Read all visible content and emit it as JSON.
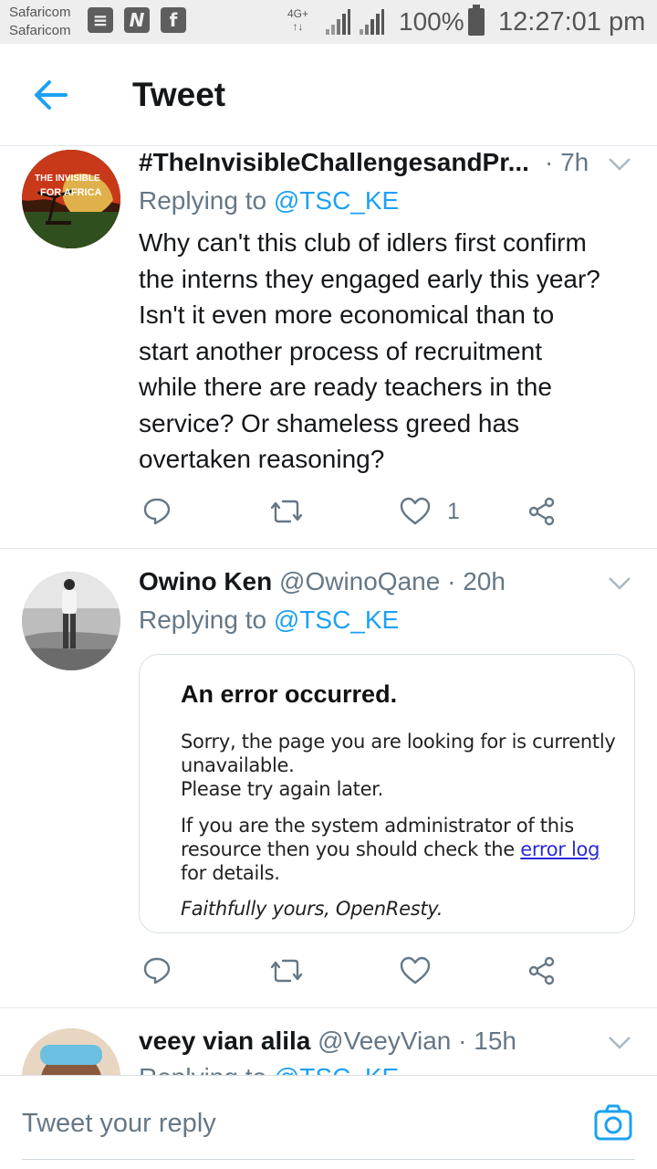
{
  "status_bar": {
    "carrier_1": "Safaricom",
    "carrier_2": "Safaricom",
    "network": "4G+",
    "battery": "100%",
    "time": "12:27:01 pm",
    "notification_icons": [
      "document-icon",
      "n-icon",
      "facebook-icon"
    ]
  },
  "header": {
    "title": "Tweet",
    "back_icon": "arrow-left-icon"
  },
  "tweets": [
    {
      "name": "#TheInvisibleChallengesandPr...",
      "handle": "",
      "time": "· 7h",
      "replying_prefix": "Replying to",
      "replying_to": "@TSC_KE",
      "avatar_text_1": "THE INVISIBLE",
      "avatar_text_2": "FOR AFRICA",
      "text_lines": [
        "Why can't this club of idlers first confirm",
        "the interns they engaged early this year?",
        "Isn't it even more economical than to",
        "start another process of recruitment",
        "while there are ready teachers in the",
        "service? Or shameless greed has",
        "overtaken reasoning?"
      ],
      "likes": "1"
    },
    {
      "name": "Owino Ken",
      "handle": "@OwinoQane",
      "time": "· 20h",
      "replying_prefix": "Replying to",
      "replying_to": "@TSC_KE",
      "card": {
        "heading": "An error occurred.",
        "line_1": "Sorry, the page you are looking for is currently",
        "line_2": "unavailable.",
        "line_3": "Please try again later.",
        "line_4": "If you are the system administrator of this",
        "line_5_prefix": "resource then you should check the ",
        "line_5_link": "error log",
        "line_6": "for details.",
        "signature": "Faithfully yours, OpenResty."
      },
      "likes": ""
    },
    {
      "name": "veey vian alila",
      "handle": "@VeeyVian",
      "time": "· 15h",
      "replying_prefix": "Replying to",
      "replying_to": "@TSC_KE"
    }
  ],
  "composer": {
    "placeholder": "Tweet your reply",
    "camera_icon": "camera-icon"
  },
  "colors": {
    "accent": "#1da1f2",
    "secondary_text": "#657786",
    "primary_text": "#14171a",
    "divider": "#e1e8ed"
  }
}
